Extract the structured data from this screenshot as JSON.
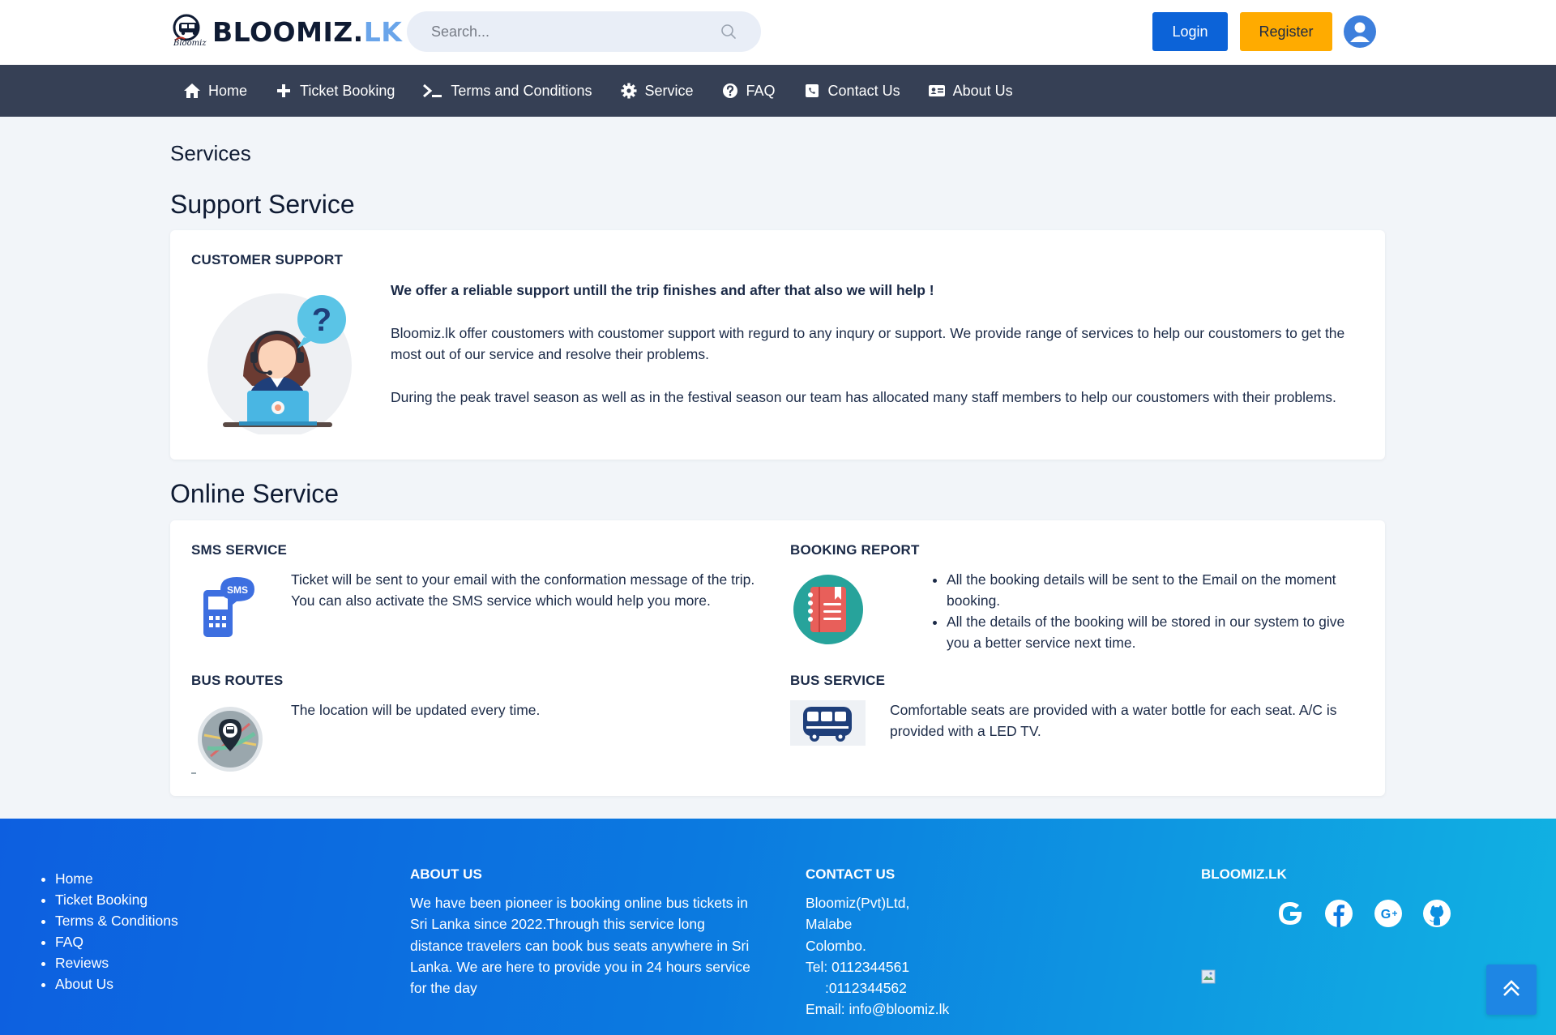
{
  "header": {
    "logo_brand": "BLOOMIZ.",
    "logo_tld": "LK",
    "logo_sub": "Bloomiz",
    "search_placeholder": "Search...",
    "login_label": "Login",
    "register_label": "Register"
  },
  "nav": [
    {
      "label": "Home",
      "icon": "home-icon"
    },
    {
      "label": "Ticket Booking",
      "icon": "plus-icon"
    },
    {
      "label": "Terms and Conditions",
      "icon": "terminal-icon"
    },
    {
      "label": "Service",
      "icon": "gear-icon"
    },
    {
      "label": "FAQ",
      "icon": "question-circle-icon"
    },
    {
      "label": "Contact Us",
      "icon": "contact-icon"
    },
    {
      "label": "About Us",
      "icon": "id-card-icon"
    }
  ],
  "main": {
    "page_title": "Services",
    "support_title": "Support Service",
    "customer_support": {
      "heading": "CUSTOMER SUPPORT",
      "lead": "We offer a reliable support untill the trip finishes and after that also we will help !",
      "p1": "Bloomiz.lk offer coustomers with coustomer support with regurd to any inqury or support. We provide range of services to help our coustomers to get the most out of our service and resolve their problems.",
      "p2": "During the peak travel season as well as in the festival season our team has allocated many staff members to help our coustomers with their problems."
    },
    "online_title": "Online Service",
    "sms": {
      "heading": "SMS SERVICE",
      "icon_label": "SMS",
      "text": "Ticket will be sent to your email with the conformation message of the trip. You can also activate the SMS service which would help you more."
    },
    "booking_report": {
      "heading": "BOOKING REPORT",
      "items": [
        "All the booking details will be sent to the Email on the moment booking.",
        "All the details of the booking will be stored in our system to give you a better service next time."
      ]
    },
    "bus_routes": {
      "heading": "BUS ROUTES",
      "text": "The location will be updated every time."
    },
    "bus_service": {
      "heading": "BUS SERVICE",
      "text": "Comfortable seats are provided with a water bottle for each seat. A/C is provided with a LED TV."
    }
  },
  "footer": {
    "links": [
      "Home",
      "Ticket Booking",
      "Terms & Conditions",
      "FAQ",
      "Reviews",
      "About Us"
    ],
    "about_title": "ABOUT US",
    "about_text": "We have been pioneer is booking online bus tickets in Sri Lanka since 2022.Through this service long distance travelers can book bus seats anywhere in Sri Lanka. We are here to provide you in 24 hours service for the day",
    "contact_title": "CONTACT US",
    "contact_lines": [
      "Bloomiz(Pvt)Ltd,",
      "Malabe",
      "Colombo.",
      "Tel: 0112344561",
      ":0112344562",
      "Email: info@bloomiz.lk"
    ],
    "brand_title": "BLOOMIZ.LK",
    "social": [
      "google-icon",
      "facebook-icon",
      "google-plus-icon",
      "github-icon"
    ]
  },
  "colors": {
    "primary": "#0c63d8",
    "accent": "#ffab00",
    "navbar": "#364055",
    "footer_start": "#0d5fe0",
    "footer_end": "#11b2e2"
  }
}
